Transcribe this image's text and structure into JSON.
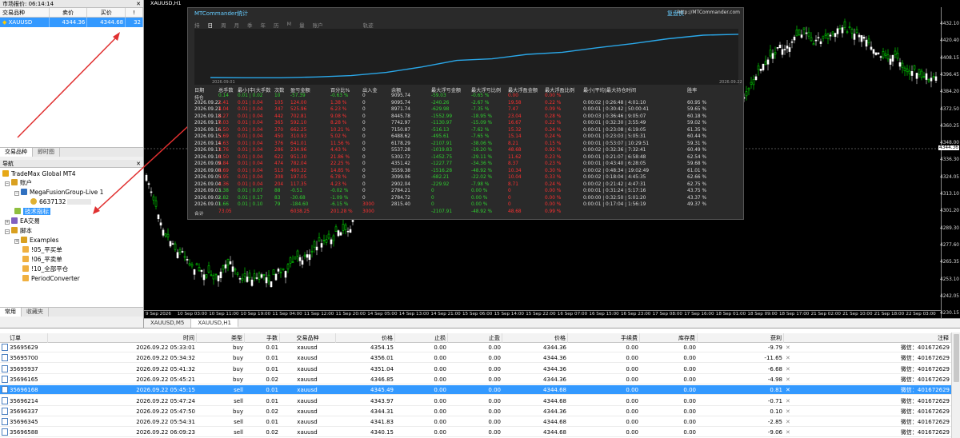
{
  "market_watch": {
    "title": "市场报价: 06:14:14",
    "headers": [
      "交易品种",
      "卖价",
      "买价",
      "!"
    ],
    "row": {
      "symbol": "XAUUSD",
      "bid": "4344.36",
      "ask": "4344.68",
      "spread": "32"
    },
    "tabs": [
      "交易品种",
      "即时图"
    ]
  },
  "navigator": {
    "title": "导航",
    "items": [
      "TradeMax Global MT4",
      "账户",
      "MegaFusionGroup-Live 1",
      "6637132",
      "技术指标",
      "EA交易",
      "脚本",
      "Examples",
      "!05_平买单",
      "!06_平卖单",
      "!10_全部平仓",
      "PeriodConverter"
    ],
    "tabs": [
      "常用",
      "收藏夹"
    ]
  },
  "chart": {
    "symbol_label": "XAUUSD,H1",
    "price_labels": [
      "4432.10",
      "4420.40",
      "4408.15",
      "4396.45",
      "4384.20",
      "4372.50",
      "4360.25",
      "4348.00",
      "4336.30",
      "4324.05",
      "4313.10",
      "4301.20",
      "4289.30",
      "4277.60",
      "4265.35",
      "4253.10",
      "4242.05",
      "4230.15"
    ],
    "current_price": "4344.36",
    "time_labels": [
      "9 Sep 2026",
      "10 Sep 03:00",
      "10 Sep 11:00",
      "10 Sep 19:00",
      "11 Sep 04:00",
      "11 Sep 12:00",
      "11 Sep 20:00",
      "14 Sep 05:00",
      "14 Sep 13:00",
      "14 Sep 21:00",
      "15 Sep 06:00",
      "15 Sep 14:00",
      "15 Sep 22:00",
      "16 Sep 07:00",
      "16 Sep 15:00",
      "16 Sep 23:00",
      "17 Sep 08:00",
      "17 Sep 16:00",
      "18 Sep 01:00",
      "18 Sep 09:00",
      "18 Sep 17:00",
      "21 Sep 02:00",
      "21 Sep 10:00",
      "21 Sep 18:00",
      "22 Sep 03:00"
    ],
    "tabs": [
      "XAUUSD,M5",
      "XAUUSD,H1"
    ]
  },
  "stats": {
    "title": "MTCommander统计",
    "brand": "复盘侠",
    "url": "http://MTCommander.com",
    "period_tabs": [
      "持",
      "日",
      "周",
      "月",
      "季",
      "年",
      "历",
      "M",
      "量",
      "账户",
      "轨迹"
    ],
    "curve_start": "2026.09.01",
    "curve_end": "2026.09.22",
    "headers": [
      "日期",
      "总手数",
      "最小|中|大手数",
      "次数",
      "盈亏金额",
      "百分比%",
      "出入金",
      "余额",
      "最大浮亏金额",
      "最大浮亏比例",
      "最大浮盈金额",
      "最大浮盈比例",
      "最小|平均|最大持仓时间",
      "胜率"
    ],
    "rows": [
      [
        "持仓",
        "0.14",
        "0.01 | 0.02",
        "10",
        "-57.39",
        "-0.63 %",
        "0",
        "9095.74",
        "-59.03",
        "-0.65 %",
        "0.00",
        "0.00 %",
        "",
        ""
      ],
      [
        "2026.09.22",
        "1.41",
        "0.01 | 0.04",
        "105",
        "124.00",
        "1.38 %",
        "0",
        "9095.74",
        "-240.26",
        "-2.67 %",
        "19.58",
        "0.22 %",
        "0:00:02 | 0:26:48 | 4:01:10",
        "60.95 %"
      ],
      [
        "2026.09.21",
        "4.04",
        "0.01 | 0.04",
        "347",
        "525.96",
        "6.23 %",
        "0",
        "8971.74",
        "-629.98",
        "-7.35 %",
        "7.47",
        "0.09 %",
        "0:00:01 | 0:30:42 | 50:00:41",
        "59.65 %"
      ],
      [
        "2026.09.18",
        "6.27",
        "0.01 | 0.04",
        "442",
        "702.81",
        "9.08 %",
        "0",
        "8445.78",
        "-1552.99",
        "-18.95 %",
        "23.04",
        "0.28 %",
        "0:00:03 | 0:36:46 | 9:05:07",
        "60.18 %"
      ],
      [
        "2026.09.17",
        "6.03",
        "0.01 | 0.04",
        "365",
        "592.10",
        "8.28 %",
        "0",
        "7742.97",
        "-1130.97",
        "-15.09 %",
        "16.67",
        "0.22 %",
        "0:00:01 | 0:32:30 | 3:55:49",
        "59.02 %"
      ],
      [
        "2026.09.16",
        "5.50",
        "0.01 | 0.04",
        "370",
        "662.25",
        "10.21 %",
        "0",
        "7150.87",
        "-516.13",
        "-7.62 %",
        "15.32",
        "0.24 %",
        "0:00:01 | 0:23:08 | 6:19:05",
        "61.35 %"
      ],
      [
        "2026.09.15",
        "5.69",
        "0.01 | 0.04",
        "450",
        "310.93",
        "5.02 %",
        "0",
        "6488.62",
        "-495.61",
        "-7.65 %",
        "15.14",
        "0.24 %",
        "0:00:01 | 0:23:03 | 5:05:31",
        "60.44 %"
      ],
      [
        "2026.09.14",
        "5.63",
        "0.01 | 0.04",
        "376",
        "641.01",
        "11.56 %",
        "0",
        "6178.29",
        "-2107.91",
        "-38.06 %",
        "8.21",
        "0.15 %",
        "0:00:01 | 0:53:07 | 10:29:51",
        "59.31 %"
      ],
      [
        "2026.09.11",
        "3.76",
        "0.01 | 0.04",
        "286",
        "234.96",
        "4.43 %",
        "0",
        "5537.28",
        "-1019.83",
        "-19.20 %",
        "48.68",
        "0.92 %",
        "0:00:02 | 0:32:36 | 7:32:41",
        "60.49 %"
      ],
      [
        "2026.09.10",
        "8.50",
        "0.01 | 0.04",
        "622",
        "951.30",
        "21.86 %",
        "0",
        "5302.72",
        "-1452.75",
        "-29.11 %",
        "11.62",
        "0.23 %",
        "0:00:01 | 0:21:07 | 6:58:48",
        "62.54 %"
      ],
      [
        "2026.09.09",
        "6.84",
        "0.01 | 0.04",
        "474",
        "782.04",
        "22.25 %",
        "0",
        "4351.42",
        "-1227.77",
        "-34.36 %",
        "8.37",
        "0.23 %",
        "0:00:01 | 0:43:40 | 6:28:05",
        "59.68 %"
      ],
      [
        "2026.09.08",
        "8.69",
        "0.01 | 0.04",
        "513",
        "460.32",
        "14.85 %",
        "0",
        "3559.38",
        "-1516.28",
        "-48.92 %",
        "10.34",
        "0.30 %",
        "0:00:02 | 0:48:34 | 19:02:49",
        "61.01 %"
      ],
      [
        "2026.09.05",
        "3.95",
        "0.01 | 0.04",
        "308",
        "197.05",
        "6.78 %",
        "0",
        "3099.06",
        "-682.21",
        "-22.02 %",
        "10.04",
        "0.33 %",
        "0:00:02 | 0:18:04 | 4:45:35",
        "62.66 %"
      ],
      [
        "2026.09.04",
        "2.36",
        "0.01 | 0.04",
        "204",
        "117.35",
        "4.23 %",
        "0",
        "2902.04",
        "-229.92",
        "-7.98 %",
        "8.71",
        "0.24 %",
        "0:00:02 | 0:21:42 | 4:47:31",
        "62.75 %"
      ],
      [
        "2026.09.03",
        "1.38",
        "0.01 | 0.07",
        "88",
        "-0.51",
        "-0.02 %",
        "0",
        "2784.21",
        "0",
        "0.00 %",
        "0",
        "0.00 %",
        "0:00:01 | 0:31:24 | 5:17:16",
        "43.75 %"
      ],
      [
        "2026.09.02",
        "1.82",
        "0.01 | 0.17",
        "83",
        "-30.68",
        "-1.09 %",
        "0",
        "2784.72",
        "0",
        "0.00 %",
        "0",
        "0.00 %",
        "0:00:00 | 0:32:50 | 5:01:20",
        "43.37 %"
      ],
      [
        "2026.09.01",
        "1.66",
        "0.01 | 0.10",
        "79",
        "-184.60",
        "-6.15 %",
        "3000",
        "2815.40",
        "0",
        "0.00 %",
        "0",
        "0.00 %",
        "0:00:01 | 0:17:04 | 1:56:19",
        "49.37 %"
      ],
      [
        "合计",
        "73.05",
        "",
        "",
        "6038.25",
        "201.28 %",
        "3000",
        "",
        "-2107.91",
        "-48.92 %",
        "48.68",
        "0.99 %",
        "",
        ""
      ]
    ]
  },
  "orders": {
    "headers": [
      "订单",
      "时间",
      "类型",
      "手数",
      "交易品种",
      "价格",
      "止损",
      "止盈",
      "价格",
      "手续费",
      "库存费",
      "获利",
      "注释"
    ],
    "rows": [
      [
        "35695629",
        "2026.09.22 05:33:01",
        "buy",
        "0.01",
        "xauusd",
        "4354.15",
        "0.00",
        "0.00",
        "4344.36",
        "0.00",
        "0.00",
        "-9.79",
        "微信：401672629"
      ],
      [
        "35695700",
        "2026.09.22 05:34:32",
        "buy",
        "0.01",
        "xauusd",
        "4356.01",
        "0.00",
        "0.00",
        "4344.36",
        "0.00",
        "0.00",
        "-11.65",
        "微信：401672629"
      ],
      [
        "35695937",
        "2026.09.22 05:41:32",
        "buy",
        "0.01",
        "xauusd",
        "4351.04",
        "0.00",
        "0.00",
        "4344.36",
        "0.00",
        "0.00",
        "-6.68",
        "微信：401672629"
      ],
      [
        "35696165",
        "2026.09.22 05:45:21",
        "buy",
        "0.02",
        "xauusd",
        "4346.85",
        "0.00",
        "0.00",
        "4344.36",
        "0.00",
        "0.00",
        "-4.98",
        "微信：401672629"
      ],
      [
        "35696168",
        "2026.09.22 05:45:15",
        "sell",
        "0.01",
        "xauusd",
        "4345.49",
        "0.00",
        "0.00",
        "4344.68",
        "0.00",
        "0.00",
        "0.81",
        "微信：401672629"
      ],
      [
        "35696214",
        "2026.09.22 05:47:24",
        "sell",
        "0.01",
        "xauusd",
        "4343.97",
        "0.00",
        "0.00",
        "4344.68",
        "0.00",
        "0.00",
        "-0.71",
        "微信：401672629"
      ],
      [
        "35696337",
        "2026.09.22 05:47:50",
        "buy",
        "0.02",
        "xauusd",
        "4344.31",
        "0.00",
        "0.00",
        "4344.36",
        "0.00",
        "0.00",
        "0.10",
        "微信：401672629"
      ],
      [
        "35696345",
        "2026.09.22 05:54:31",
        "sell",
        "0.01",
        "xauusd",
        "4341.83",
        "0.00",
        "0.00",
        "4344.68",
        "0.00",
        "0.00",
        "-2.85",
        "微信：401672629"
      ],
      [
        "35696588",
        "2026.09.22 06:09:23",
        "sell",
        "0.02",
        "xauusd",
        "4340.15",
        "0.00",
        "0.00",
        "4344.68",
        "0.00",
        "0.00",
        "-9.06",
        "微信：401672629"
      ]
    ],
    "selected_index": 4
  },
  "colors": {
    "accent": "#3399ff",
    "bull": "#00d000",
    "bear": "#ffffff",
    "loss_red": "#ff3030",
    "profit_green": "#30d030",
    "curve": "#2aa7e8"
  }
}
